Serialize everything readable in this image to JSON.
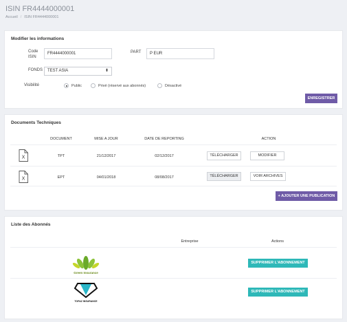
{
  "header": {
    "title": "ISIN FR4444000001",
    "breadcrumb": [
      "Accueil",
      "ISIN FR4444000001"
    ]
  },
  "form": {
    "title": "Modifier les informations",
    "code_isin_label": "Code ISIN",
    "code_isin_value": "FR4444000001",
    "part_label": "PART",
    "part_value": "P EUR",
    "fonds_label": "FONDS",
    "fonds_value": "TEST ASIA",
    "visibilite_label": "Visibilité",
    "visibility_options": [
      "Public",
      "Privé (réservé aux abonnés)",
      "Désactivé"
    ],
    "visibility_selected": "Public",
    "save_label": "ENREGISTRER"
  },
  "documents": {
    "title": "Documents Techniques",
    "columns": [
      "DOCUMENT",
      "MISE A JOUR",
      "DATE DE REPORTING",
      "ACTION"
    ],
    "rows": [
      {
        "document": "TPT",
        "updated": "21/12/2017",
        "reporting": "02/12/2017",
        "action1": "TÉLÉCHARGER",
        "action2": "MODIFIER"
      },
      {
        "document": "EPT",
        "updated": "04/01/2018",
        "reporting": "08/08/2017",
        "action1": "TÉLÉCHARGER",
        "action2": "VOIR ARCHIVES"
      }
    ],
    "add_label": "+ AJOUTER UNE PUBLICATION"
  },
  "subscribers": {
    "title": "Liste des Abonnés",
    "columns": [
      "Entreprise",
      "Actions"
    ],
    "rows": [
      {
        "logo_text": "Green Insurance",
        "action": "SUPPRIMER L'ABONNEMENT"
      },
      {
        "logo_text": "TOPAZ INSURANCE",
        "action": "SUPPRIMER L'ABONNEMENT"
      }
    ]
  },
  "colors": {
    "accent_purple": "#6f5ba7",
    "accent_teal": "#2eb8b8"
  }
}
